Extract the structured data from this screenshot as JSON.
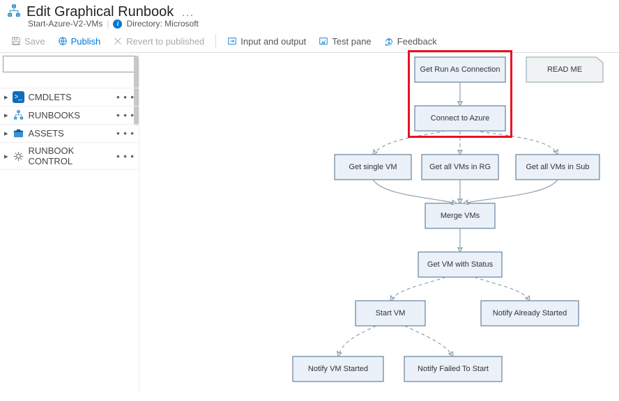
{
  "header": {
    "title": "Edit Graphical Runbook",
    "more": "...",
    "subtitle_name": "Start-Azure-V2-VMs",
    "directory_label": "Directory: Microsoft"
  },
  "toolbar": {
    "save": "Save",
    "publish": "Publish",
    "revert": "Revert to published",
    "io": "Input and output",
    "test": "Test pane",
    "feedback": "Feedback"
  },
  "search": {
    "placeholder": ""
  },
  "tree": {
    "items": [
      {
        "label": "CMDLETS",
        "icon": "cmd",
        "more": "• • •"
      },
      {
        "label": "RUNBOOKS",
        "icon": "runbook",
        "more": "• • •"
      },
      {
        "label": "ASSETS",
        "icon": "assets",
        "more": "• • •"
      },
      {
        "label": "RUNBOOK CONTROL",
        "icon": "control",
        "more": "• • •"
      }
    ]
  },
  "canvas": {
    "nodes": {
      "n1": "Get Run As Connection",
      "n2": "Connect to Azure",
      "n3": "Get single VM",
      "n4": "Get all VMs in RG",
      "n5": "Get all VMs in Sub",
      "n6": "Merge VMs",
      "n7": "Get VM with Status",
      "n8": "Start VM",
      "n9": "Notify Already Started",
      "n10": "Notify VM Started",
      "n11": "Notify Failed To Start",
      "readme": "READ ME"
    },
    "highlight_note": "red box around Get Run As Connection and Connect to Azure"
  }
}
